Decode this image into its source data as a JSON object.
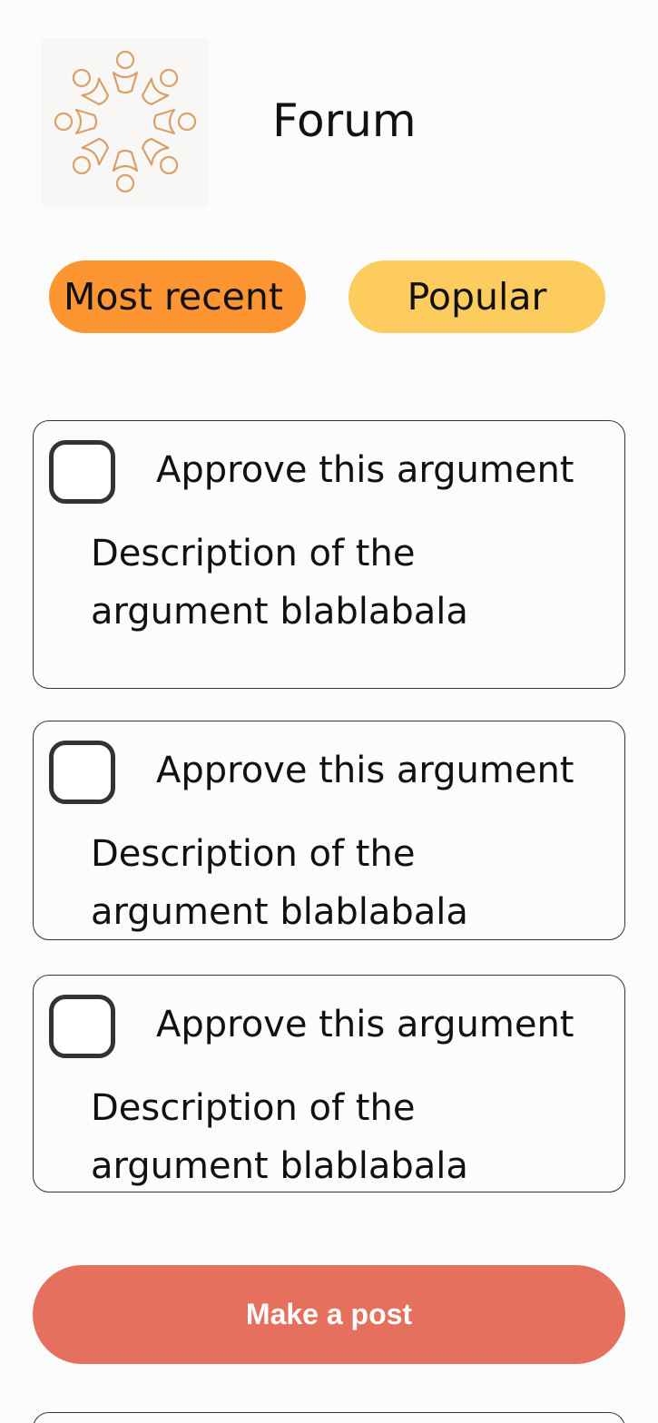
{
  "header": {
    "title": "Forum",
    "logo_icon": "people-circle-icon",
    "logo_color": "#d9a06a"
  },
  "tabs": [
    {
      "label": "Most recent",
      "color": "#fc9532"
    },
    {
      "label": "Popular",
      "color": "#fdcc5e"
    }
  ],
  "arguments": [
    {
      "approve_label": "Approve this argument",
      "description": "Description of the argument blablabala"
    },
    {
      "approve_label": "Approve this argument",
      "description": "Description of the argument blablabala"
    },
    {
      "approve_label": "Approve this argument",
      "description": "Description of the argument blablabala"
    }
  ],
  "actions": {
    "make_post_label": "Make a post",
    "make_post_color": "#e5705e"
  }
}
